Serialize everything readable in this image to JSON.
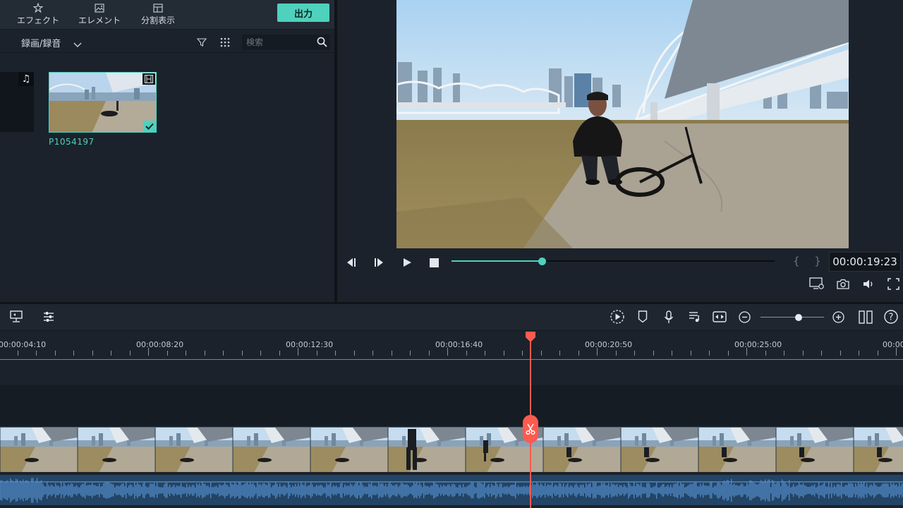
{
  "toolbar": {
    "effects_label": "エフェクト",
    "elements_label": "エレメント",
    "split_label": "分割表示",
    "export_label": "出力"
  },
  "library": {
    "title": "録画/録音",
    "search_placeholder": "検索",
    "items": [
      {
        "type": "audio",
        "icon": "music-note-icon"
      },
      {
        "type": "video",
        "label": "P1054197",
        "selected": true
      }
    ]
  },
  "player": {
    "timecode": "00:00:19:23",
    "progress": 0.28,
    "braces": "{ }"
  },
  "timeline": {
    "ruler_labels": [
      "00:00:04:10",
      "00:00:08:20",
      "00:00:12:30",
      "00:00:16:40",
      "00:00:20:50",
      "00:00:25:00",
      "00:00"
    ],
    "zoom_level": 0.55
  },
  "colors": {
    "accent": "#4ed1bd",
    "playhead": "#ff5a4f",
    "panel": "#1b222b",
    "audio_wave": "#4f86c2"
  }
}
